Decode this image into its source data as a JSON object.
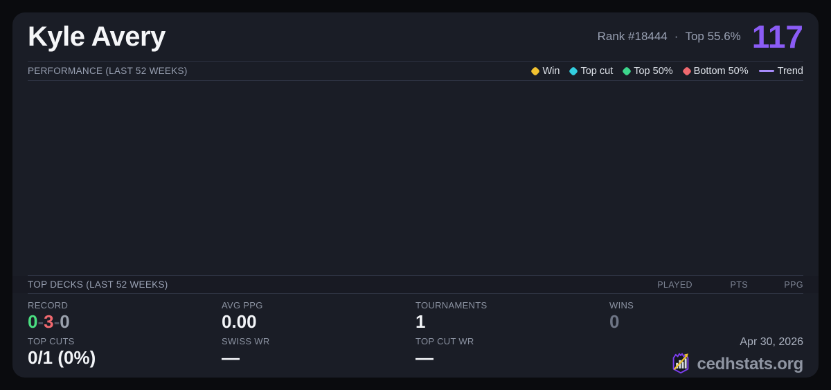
{
  "header": {
    "player_name": "Kyle Avery",
    "rank_label": "Rank #18444",
    "dot_separator": "·",
    "top_percent_label": "Top 55.6%",
    "score": "117"
  },
  "performance": {
    "section_title": "PERFORMANCE (LAST 52 WEEKS)",
    "legend": [
      {
        "label": "Win",
        "color": "#f2c230",
        "swatch": "dot"
      },
      {
        "label": "Top cut",
        "color": "#33cfe0",
        "swatch": "dot"
      },
      {
        "label": "Top 50%",
        "color": "#3dd68c",
        "swatch": "dot"
      },
      {
        "label": "Bottom 50%",
        "color": "#f0696f",
        "swatch": "dot"
      },
      {
        "label": "Trend",
        "color": "#a78bfa",
        "swatch": "line"
      }
    ]
  },
  "top_decks": {
    "section_title": "TOP DECKS (LAST 52 WEEKS)",
    "columns": [
      "PLAYED",
      "PTS",
      "PPG"
    ],
    "rows": []
  },
  "stats": {
    "record": {
      "label": "RECORD",
      "wins": "0",
      "sep1": "-",
      "losses": "3",
      "sep2": "-",
      "draws": "0"
    },
    "top_cuts": {
      "label": "TOP CUTS",
      "value": "0/1 (0%)"
    },
    "avg_ppg": {
      "label": "AVG PPG",
      "value": "0.00"
    },
    "swiss_wr": {
      "label": "SWISS WR",
      "value": "—"
    },
    "tournaments": {
      "label": "TOURNAMENTS",
      "value": "1"
    },
    "top_cut_wr": {
      "label": "TOP CUT WR",
      "value": "—"
    },
    "wins": {
      "label": "WINS",
      "value": "0"
    }
  },
  "footer": {
    "date": "Apr 30, 2026",
    "brand": "cedhstats.org",
    "logo": "bar-chart-shield-logo"
  },
  "colors": {
    "page_bg": "#0a0b0e",
    "card_bg": "#1a1d26",
    "divider": "#2e3342",
    "accent_purple": "#8b5cf6",
    "record_win_green": "#4ade80",
    "record_loss_red": "#f0696f",
    "record_draw_gray": "#9aa1ad",
    "muted_text": "#8b92a1",
    "value_text": "#f2f4f7"
  }
}
